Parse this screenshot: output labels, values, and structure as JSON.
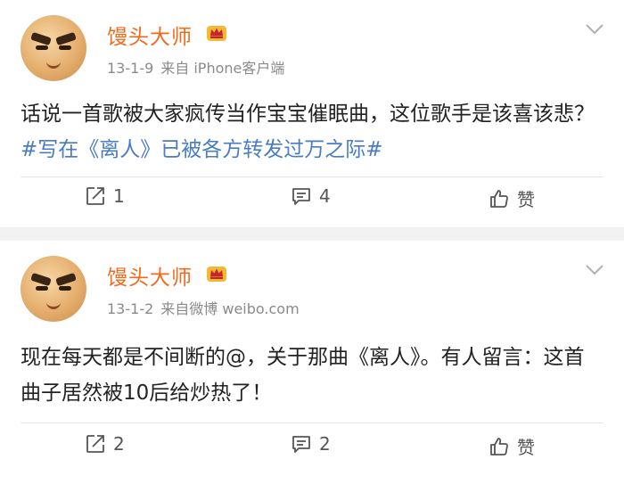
{
  "posts": [
    {
      "author": "馒头大师",
      "date": "13-1-9",
      "source": "来自 iPhone客户端",
      "text": "话说一首歌被大家疯传当作宝宝催眠曲，这位歌手是该喜该悲？",
      "hashtag": "#写在《离人》已被各方转发过万之际#",
      "reposts": "1",
      "comments": "4",
      "like_label": "赞"
    },
    {
      "author": "馒头大师",
      "date": "13-1-2",
      "source": "来自微博 weibo.com",
      "text": "现在每天都是不间断的@，关于那曲《离人》。有人留言：这首曲子居然被10后给炒热了！",
      "hashtag": "",
      "reposts": "2",
      "comments": "2",
      "like_label": "赞"
    }
  ],
  "colors": {
    "author": "#f06a1c",
    "hashtag": "#4a7cc2",
    "meta": "#8a8a8a",
    "background": "#f2f2f2"
  },
  "icons": [
    "avatar",
    "vip-crown-icon",
    "chevron-down-icon",
    "repost-icon",
    "comment-icon",
    "like-icon"
  ]
}
